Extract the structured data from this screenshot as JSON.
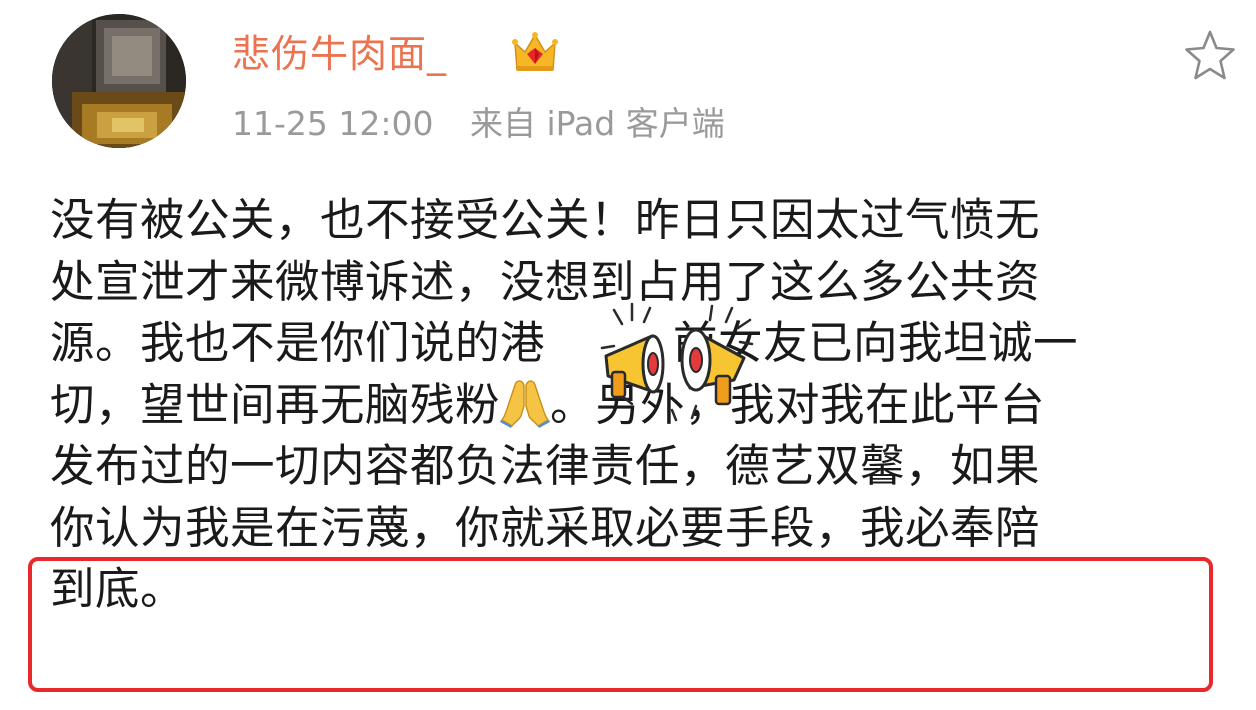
{
  "post": {
    "username": "悲伤牛肉面_",
    "badge_icon": "crown-icon",
    "time": "11-25 12:00",
    "source": "来自 iPad 客户端",
    "favorite_icon": "star-outline-icon",
    "lines": [
      "没有被公关，也不接受公关！昨日只因太过气愤无",
      "处宣泄才来微博诉述，没想到占用了这么多公共资",
      "源。我也不是你们说的港",
      "前女友已向我坦诚一",
      "切，望世间再无脑残粉",
      "。另外，我对我在此平台",
      "发布过的一切内容都负法律责任，德艺双馨，如果",
      "你认为我是在污蔑，你就采取必要手段，我必奉陪",
      "到底。"
    ],
    "highlight_color": "#e8282b",
    "username_color": "#eb7350"
  }
}
